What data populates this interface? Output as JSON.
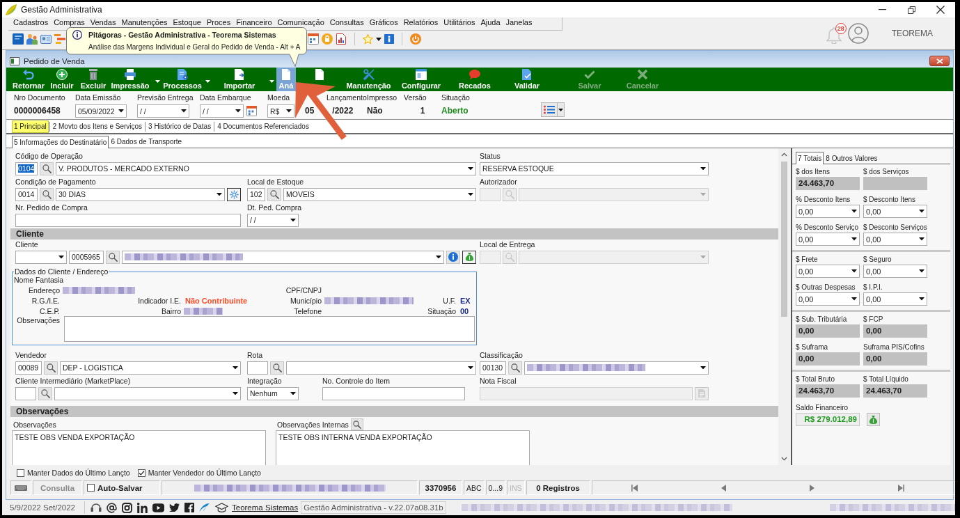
{
  "window": {
    "title": "Gestão Administrativa"
  },
  "menu": [
    "Cadastros",
    "Compras",
    "Vendas",
    "Manutenções",
    "Estoque",
    "Proces",
    "Financeiro",
    "Comunicação",
    "Consultas",
    "Gráficos",
    "Relatórios",
    "Utilitários",
    "Ajuda",
    "Janelas"
  ],
  "notifications": {
    "count": "28"
  },
  "user": {
    "name": "TEOREMA"
  },
  "tooltip": {
    "title": "Pitágoras - Gestão Administrativa - Teorema Sistemas",
    "text": "Análise das Margens Individual e Geral do Pedido de Venda - Alt + A"
  },
  "order_window": {
    "title": "Pedido de Venda"
  },
  "toolbar": [
    {
      "label": "Retornar",
      "dropdown": false,
      "disabled": false,
      "highlighted": false
    },
    {
      "label": "Incluir",
      "dropdown": false,
      "disabled": false,
      "highlighted": false
    },
    {
      "label": "Excluir",
      "dropdown": false,
      "disabled": false,
      "highlighted": false
    },
    {
      "label": "Impressão",
      "dropdown": true,
      "disabled": false,
      "highlighted": false
    },
    {
      "label": "Processos",
      "dropdown": true,
      "disabled": false,
      "highlighted": false
    },
    {
      "label": "Importar",
      "dropdown": true,
      "disabled": false,
      "highlighted": false
    },
    {
      "label": "Aná",
      "dropdown": false,
      "disabled": false,
      "highlighted": true
    },
    {
      "dropdown": false,
      "disabled": false,
      "highlighted": false
    },
    {
      "label": "Manutenção",
      "dropdown": false,
      "disabled": false,
      "highlighted": false
    },
    {
      "label": "Configurar",
      "dropdown": false,
      "disabled": false,
      "highlighted": false
    },
    {
      "label": "Recados",
      "dropdown": false,
      "disabled": false,
      "highlighted": false
    },
    {
      "label": "Validar",
      "dropdown": false,
      "disabled": false,
      "highlighted": false
    },
    {
      "label": "Salvar",
      "dropdown": false,
      "disabled": true,
      "highlighted": false
    },
    {
      "label": "Cancelar",
      "dropdown": false,
      "disabled": true,
      "highlighted": false
    }
  ],
  "header": [
    {
      "label": "Nro Documento",
      "value": "0000006458",
      "kind": "text"
    },
    {
      "label": "Data Emissão",
      "value": "05/09/2022",
      "kind": "combo"
    },
    {
      "label": "Previsão Entrega",
      "value": "/ /",
      "kind": "combo"
    },
    {
      "label": "Data Embarque",
      "value": "/ /",
      "kind": "combo-calendar"
    },
    {
      "label": "Moeda",
      "value": "R$",
      "kind": "combo"
    },
    {
      "label": "Lançamento",
      "value_parts": [
        "05",
        "/2022"
      ],
      "kind": "split"
    },
    {
      "label": "Impresso",
      "value": "Não",
      "kind": "text"
    },
    {
      "label": "Versão",
      "value": "1",
      "kind": "number"
    },
    {
      "label": "Situação",
      "value": "Aberto",
      "kind": "status"
    }
  ],
  "tabs": [
    {
      "label": "1 Principal",
      "selected": true
    },
    {
      "label": "2 Movto dos Itens e Serviços",
      "selected": false
    },
    {
      "label": "3 Histórico de Datas",
      "selected": false
    },
    {
      "label": "4 Documentos Referenciados",
      "selected": false
    }
  ],
  "subtabs": [
    {
      "label": "5 Informações do Destinatário",
      "selected": true
    },
    {
      "label": "6 Dados de Transporte",
      "selected": false
    }
  ],
  "form": [
    {
      "kind": "row-wide",
      "fields": [
        {
          "label": "Código de Operação",
          "disabled": false,
          "controls": [
            {
              "kind": "code",
              "value": "0104",
              "highlighted": true
            },
            {
              "kind": "search"
            },
            {
              "kind": "combo",
              "value": "V. PRODUTOS - MERCADO EXTERNO"
            }
          ]
        },
        {
          "label": "Status",
          "disabled": false,
          "controls": [
            {
              "kind": "combo",
              "value": "RESERVA ESTOQUE"
            }
          ]
        }
      ]
    },
    {
      "kind": "row-three",
      "fields": [
        {
          "label": "Condição de Pagamento",
          "disabled": false,
          "controls": [
            {
              "kind": "code",
              "value": "0014",
              "highlighted": false
            },
            {
              "kind": "search"
            },
            {
              "kind": "combo",
              "value": "30 DIAS"
            },
            {
              "kind": "gear"
            }
          ]
        },
        {
          "label": "Local de Estoque",
          "disabled": false,
          "controls": [
            {
              "kind": "code",
              "value": "102",
              "highlighted": false
            },
            {
              "kind": "search"
            },
            {
              "kind": "combo",
              "value": "MOVEIS"
            }
          ]
        },
        {
          "label": "Autorizador",
          "disabled": true,
          "controls": [
            {
              "kind": "code"
            },
            {
              "kind": "search"
            },
            {
              "kind": "combo"
            }
          ]
        }
      ]
    },
    {
      "kind": "row-three",
      "fields": [
        {
          "label": "Nr. Pedido de Compra",
          "disabled": false,
          "controls": [
            {
              "kind": "input"
            }
          ]
        },
        {
          "label": "Dt. Ped. Compra",
          "disabled": false,
          "controls": [
            {
              "kind": "combo-short",
              "value": "/ /"
            }
          ]
        }
      ]
    },
    {
      "kind": "section",
      "title": "Cliente"
    },
    {
      "kind": "row-wide",
      "fields": [
        {
          "label": "Cliente",
          "disabled": false,
          "controls": [
            {
              "kind": "combo-short"
            },
            {
              "kind": "code",
              "value": "0005965",
              "highlighted": false
            },
            {
              "kind": "search"
            },
            {
              "kind": "combo-redacted"
            },
            {
              "kind": "info"
            },
            {
              "kind": "money"
            }
          ]
        },
        {
          "label": "Local de Entrega",
          "disabled": true,
          "controls": [
            {
              "kind": "code"
            },
            {
              "kind": "search"
            },
            {
              "kind": "combo"
            }
          ]
        }
      ]
    },
    {
      "kind": "client-box",
      "title": "Dados do Cliente / Endereço",
      "heading": "Nome Fantasia",
      "rows": [
        [
          {
            "label": "Endereço",
            "kind": "redacted"
          },
          null,
          {
            "label": "CPF/CNPJ",
            "kind": "plain"
          },
          null
        ],
        [
          {
            "label": "R.G./I.E.",
            "kind": "plain"
          },
          {
            "label": "Indicador I.E.",
            "value": "Não Contribuinte",
            "kind": "warning"
          },
          {
            "label": "Município",
            "kind": "redacted"
          },
          {
            "label": "U.F.",
            "value": "EX",
            "kind": "code"
          }
        ],
        [
          {
            "label": "C.E.P.",
            "kind": "plain"
          },
          {
            "label": "Bairro",
            "kind": "redacted"
          },
          {
            "label": "Telefone",
            "kind": "plain"
          },
          {
            "label": "Situação",
            "value": "00",
            "kind": "code"
          }
        ]
      ],
      "notes_label": "Observações"
    },
    {
      "kind": "row-three",
      "fields": [
        {
          "label": "Vendedor",
          "disabled": false,
          "controls": [
            {
              "kind": "code",
              "value": "00089",
              "highlighted": false
            },
            {
              "kind": "search"
            },
            {
              "kind": "combo",
              "value": "DEP - LOGISTICA"
            }
          ]
        },
        {
          "label": "Rota",
          "disabled": false,
          "controls": [
            {
              "kind": "code"
            },
            {
              "kind": "search"
            },
            {
              "kind": "combo"
            }
          ]
        },
        {
          "label": "Classificação",
          "disabled": false,
          "controls": [
            {
              "kind": "code",
              "value": "00130",
              "highlighted": false
            },
            {
              "kind": "search"
            },
            {
              "kind": "combo-redacted"
            }
          ]
        }
      ]
    },
    {
      "kind": "row-four",
      "fields": [
        {
          "label": "Cliente Intermediário (MarketPlace)",
          "disabled": false,
          "controls": [
            {
              "kind": "code"
            },
            {
              "kind": "search"
            },
            {
              "kind": "combo"
            }
          ]
        },
        {
          "label": "Integração",
          "disabled": false,
          "controls": [
            {
              "kind": "combo-short",
              "value": "Nenhum"
            }
          ]
        },
        {
          "label": "No. Controle do Item",
          "disabled": false,
          "controls": [
            {
              "kind": "input"
            }
          ]
        },
        {
          "label": "Nota Fiscal",
          "disabled": true,
          "controls": [
            {
              "kind": "input"
            },
            {
              "kind": "doc"
            }
          ]
        }
      ]
    },
    {
      "kind": "section",
      "title": "Observações"
    },
    {
      "kind": "notes",
      "fields": [
        {
          "label": "Observações",
          "value": "TESTE OBS VENDA EXPORTAÇÃO",
          "search": false
        },
        {
          "label": "Observações Internas",
          "value": "TESTE OBS INTERNA VENDA EXPORTAÇÃO",
          "search": true
        }
      ]
    }
  ],
  "totals": {
    "tabs": [
      {
        "label": "7 Totais",
        "selected": true
      },
      {
        "label": "8 Outros Valores",
        "selected": false
      }
    ],
    "groups": [
      {
        "fields": [
          {
            "label": "$ dos Itens",
            "kind": "readonly",
            "value": "24.463,70"
          },
          {
            "label": "$ dos Serviços",
            "kind": "readonly"
          },
          {
            "label": "% Desconto Itens",
            "kind": "dropdown",
            "value": "0,00"
          },
          {
            "label": "$ Desconto Itens",
            "kind": "dropdown",
            "value": "0,00"
          },
          {
            "label": "% Desconto Serviço",
            "kind": "dropdown",
            "value": "0,00"
          },
          {
            "label": "$ Desconto Serviços",
            "kind": "dropdown",
            "value": "0,00"
          }
        ]
      },
      {
        "fields": [
          {
            "label": "$ Frete",
            "kind": "dropdown",
            "value": "0,00"
          },
          {
            "label": "$ Seguro",
            "kind": "dropdown",
            "value": "0,00"
          },
          {
            "label": "$ Outras Despesas",
            "kind": "dropdown",
            "value": "0,00"
          },
          {
            "label": "$ I.P.I.",
            "kind": "dropdown",
            "value": "0,00"
          }
        ]
      },
      {
        "fields": [
          {
            "label": "$ Sub. Tributária",
            "kind": "readonly",
            "value": "0,00"
          },
          {
            "label": "$ FCP",
            "kind": "readonly",
            "value": "0,00"
          },
          {
            "label": "$ Suframa",
            "kind": "readonly",
            "value": "0,00"
          },
          {
            "label": "Suframa PIS/Cofins",
            "kind": "readonly",
            "value": "0,00"
          }
        ]
      },
      {
        "fields": [
          {
            "label": "$ Total Bruto",
            "kind": "readonly",
            "value": "24.463,70"
          },
          {
            "label": "$ Total Líquido",
            "kind": "readonly",
            "value": "24.463,70"
          }
        ]
      }
    ],
    "balance": {
      "label": "Saldo Financeiro",
      "value": "R$ 279.012,89"
    }
  },
  "options": [
    {
      "label": "Manter Dados do Último Lançto",
      "checked": false
    },
    {
      "label": "Manter Vendedor do Último Lançto",
      "checked": true
    }
  ],
  "record_bar": {
    "mode": "Consulta",
    "autosave": {
      "label": "Auto-Salvar",
      "checked": false
    },
    "code": "3370956",
    "indicators": [
      {
        "label": "ABC",
        "disabled": false
      },
      {
        "label": "0...9",
        "disabled": false
      },
      {
        "label": "INS",
        "disabled": true
      }
    ],
    "records": "0 Registros"
  },
  "status_bar": {
    "date": "5/9/2022 Set/2022",
    "link": "Teorema Sistemas",
    "version": "Gestão Administrativa - v.22.07a08.31b"
  }
}
